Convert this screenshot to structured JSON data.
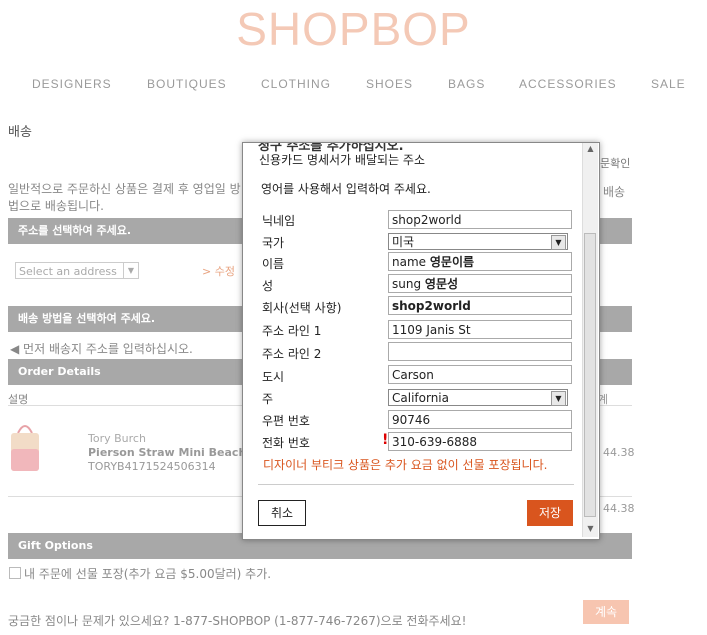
{
  "logo": "SHOPBOP",
  "nav": [
    "DESIGNERS",
    "BOUTIQUES",
    "CLOTHING",
    "SHOES",
    "BAGS",
    "ACCESSORIES",
    "SALE"
  ],
  "page": {
    "title": "배송",
    "confirm_label": "문확인",
    "info": "일반적으로 주문하신 상품은 결제 후 영업일 방법으로 배송됩니다.",
    "info_right": "배송",
    "address_bar": "주소를 선택하여 주세요.",
    "select_address_placeholder": "Select an address",
    "modify_link": "> 수정",
    "shipping_bar": "배송 방법을 선택하여 주세요.",
    "enter_address_first": "◀ 먼저 배송지 주소를 입력하십시오.",
    "order_details_bar": "Order Details",
    "description_header": "설명",
    "product": {
      "brand": "Tory Burch",
      "name": "Pierson Straw Mini Beach T",
      "sku": "TORYB4171524506314",
      "price": "44.38",
      "total": "44.38",
      "column_head": "계"
    },
    "gift_bar": "Gift Options",
    "gift_option": "내 주문에 선물 포장(추가 요금 $5.00달러) 추가.",
    "help_text": "궁금한 점이나 문제가 있으세요? 1-877-SHOPBOP (1-877-746-7267)으로 전화주세요!",
    "continue_label": "계속"
  },
  "modal": {
    "cut_heading": "청구 주소를 추가하십시오.",
    "subtitle": "신용카드 명세서가 배달되는 주소",
    "language_note": "영어를 사용해서 입력하여 주세요.",
    "fields": {
      "nickname": {
        "label": "닉네임",
        "value": "shop2world"
      },
      "country": {
        "label": "국가",
        "value": "미국"
      },
      "first_name": {
        "label": "이름",
        "value": "name",
        "annotation": "영문이름"
      },
      "last_name": {
        "label": "성",
        "value": "sung",
        "annotation": "영문성"
      },
      "company": {
        "label": "회사(선택 사항)",
        "value": "shop2world"
      },
      "address1": {
        "label": "주소 라인 1",
        "value": "1109 Janis St"
      },
      "address2": {
        "label": "주소 라인 2",
        "value": ""
      },
      "city": {
        "label": "도시",
        "value": "Carson"
      },
      "state": {
        "label": "주",
        "value": "California"
      },
      "zip": {
        "label": "우편 번호",
        "value": "90746"
      },
      "phone": {
        "label": "전화 번호",
        "value": "310-639-6888"
      }
    },
    "note": "디자이너 부티크 상품은 추가 요금 없이 선물 포장됩니다.",
    "cancel_label": "취소",
    "save_label": "저장"
  },
  "colors": {
    "brand": "#f4c9b6",
    "accent": "#d9551e",
    "bar": "#a8a8a8"
  }
}
